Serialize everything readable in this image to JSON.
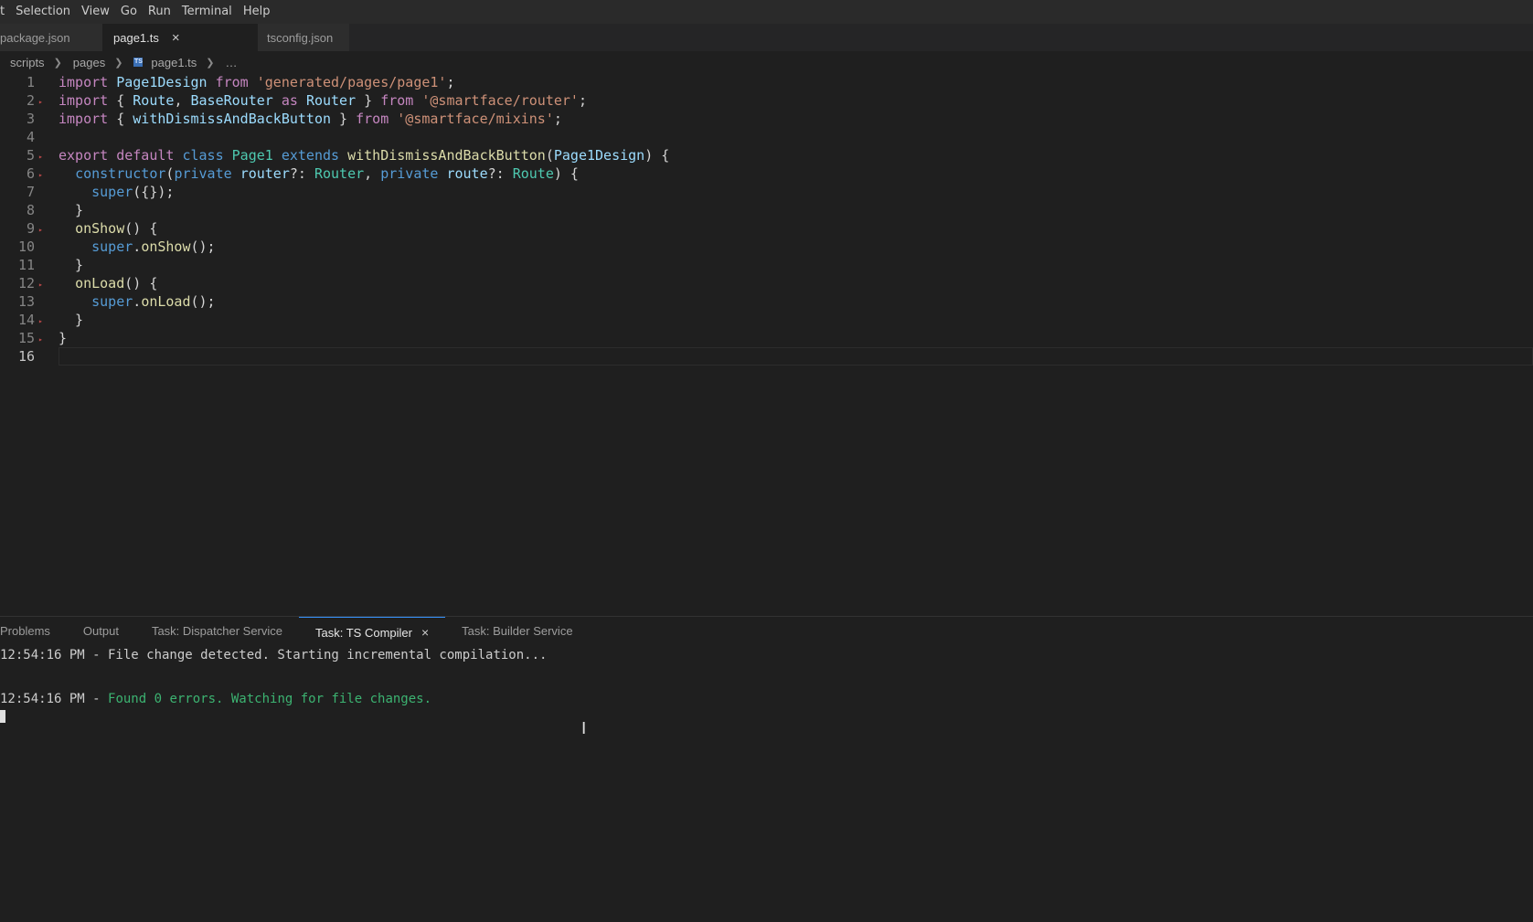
{
  "menubar": {
    "items": [
      "t",
      "Selection",
      "View",
      "Go",
      "Run",
      "Terminal",
      "Help"
    ]
  },
  "tabs": [
    {
      "label": "package.json",
      "active": false
    },
    {
      "label": "page1.ts",
      "active": true,
      "close": "×"
    },
    {
      "label": "tsconfig.json",
      "active": false
    }
  ],
  "breadcrumb": {
    "items": [
      "scripts",
      "pages",
      "page1.ts",
      "…"
    ],
    "ts_icon": "TS"
  },
  "editor": {
    "line_numbers": [
      "1",
      "2",
      "3",
      "4",
      "5",
      "6",
      "7",
      "8",
      "9",
      "10",
      "11",
      "12",
      "13",
      "14",
      "15",
      "16"
    ],
    "lines": [
      [
        [
          "kw",
          "import"
        ],
        [
          "pun",
          " "
        ],
        [
          "var",
          "Page1Design"
        ],
        [
          "pun",
          " "
        ],
        [
          "kw",
          "from"
        ],
        [
          "pun",
          " "
        ],
        [
          "str",
          "'generated/pages/page1'"
        ],
        [
          "pun",
          ";"
        ]
      ],
      [
        [
          "kw",
          "import"
        ],
        [
          "pun",
          " { "
        ],
        [
          "var",
          "Route"
        ],
        [
          "pun",
          ", "
        ],
        [
          "var",
          "BaseRouter"
        ],
        [
          "pun",
          " "
        ],
        [
          "kw",
          "as"
        ],
        [
          "pun",
          " "
        ],
        [
          "var",
          "Router"
        ],
        [
          "pun",
          " } "
        ],
        [
          "kw",
          "from"
        ],
        [
          "pun",
          " "
        ],
        [
          "str",
          "'@smartface/router'"
        ],
        [
          "pun",
          ";"
        ]
      ],
      [
        [
          "kw",
          "import"
        ],
        [
          "pun",
          " { "
        ],
        [
          "var",
          "withDismissAndBackButton"
        ],
        [
          "pun",
          " } "
        ],
        [
          "kw",
          "from"
        ],
        [
          "pun",
          " "
        ],
        [
          "str",
          "'@smartface/mixins'"
        ],
        [
          "pun",
          ";"
        ]
      ],
      [],
      [
        [
          "kw",
          "export"
        ],
        [
          "pun",
          " "
        ],
        [
          "kw",
          "default"
        ],
        [
          "pun",
          " "
        ],
        [
          "kw2",
          "class"
        ],
        [
          "pun",
          " "
        ],
        [
          "ty",
          "Page1"
        ],
        [
          "pun",
          " "
        ],
        [
          "kw2",
          "extends"
        ],
        [
          "pun",
          " "
        ],
        [
          "fn",
          "withDismissAndBackButton"
        ],
        [
          "pun",
          "("
        ],
        [
          "var",
          "Page1Design"
        ],
        [
          "pun",
          ") {"
        ]
      ],
      [
        [
          "pun",
          "  "
        ],
        [
          "kw2",
          "constructor"
        ],
        [
          "pun",
          "("
        ],
        [
          "kw2",
          "private"
        ],
        [
          "pun",
          " "
        ],
        [
          "var",
          "router"
        ],
        [
          "pun",
          "?: "
        ],
        [
          "ty",
          "Router"
        ],
        [
          "pun",
          ", "
        ],
        [
          "kw2",
          "private"
        ],
        [
          "pun",
          " "
        ],
        [
          "var",
          "route"
        ],
        [
          "pun",
          "?: "
        ],
        [
          "ty",
          "Route"
        ],
        [
          "pun",
          ") {"
        ]
      ],
      [
        [
          "pun",
          "    "
        ],
        [
          "kw2",
          "super"
        ],
        [
          "pun",
          "({});"
        ]
      ],
      [
        [
          "pun",
          "  }"
        ]
      ],
      [
        [
          "pun",
          "  "
        ],
        [
          "fn",
          "onShow"
        ],
        [
          "pun",
          "() {"
        ]
      ],
      [
        [
          "pun",
          "    "
        ],
        [
          "kw2",
          "super"
        ],
        [
          "pun",
          "."
        ],
        [
          "fn",
          "onShow"
        ],
        [
          "pun",
          "();"
        ]
      ],
      [
        [
          "pun",
          "  }"
        ]
      ],
      [
        [
          "pun",
          "  "
        ],
        [
          "fn",
          "onLoad"
        ],
        [
          "pun",
          "() {"
        ]
      ],
      [
        [
          "pun",
          "    "
        ],
        [
          "kw2",
          "super"
        ],
        [
          "pun",
          "."
        ],
        [
          "fn",
          "onLoad"
        ],
        [
          "pun",
          "();"
        ]
      ],
      [
        [
          "pun",
          "  }"
        ]
      ],
      [
        [
          "pun",
          "}"
        ]
      ],
      []
    ]
  },
  "panel": {
    "tabs": [
      "Problems",
      "Output",
      "Task: Dispatcher Service",
      "Task: TS Compiler",
      "Task: Builder Service"
    ],
    "active_tab": "Task: TS Compiler",
    "close": "×",
    "terminal": {
      "line1": "12:54:16 PM - File change detected. Starting incremental compilation...",
      "line2_time": "12:54:16 PM - ",
      "line2_msg": "Found 0 errors. Watching for file changes."
    }
  },
  "cursor_glyph": "I"
}
